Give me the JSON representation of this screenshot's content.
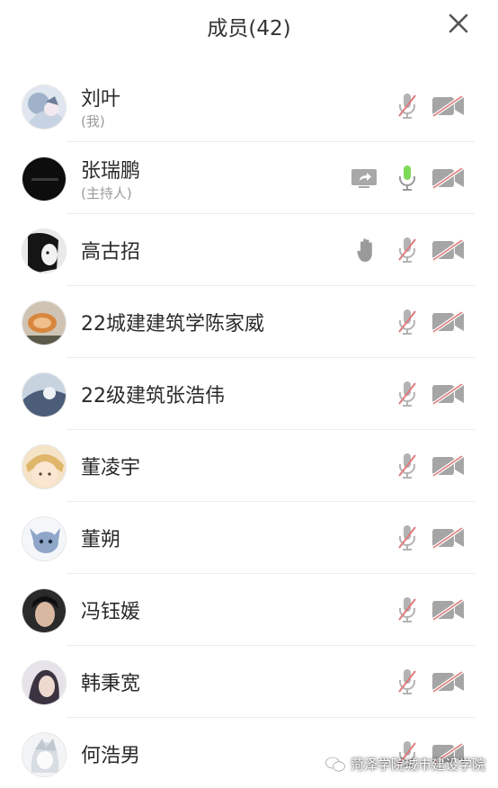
{
  "header": {
    "title": "成员(42)"
  },
  "members": [
    {
      "name": "刘叶",
      "role": "(我)"
    },
    {
      "name": "张瑞鹏",
      "role": "(主持人)"
    },
    {
      "name": "高古招"
    },
    {
      "name": "22城建建筑学陈家威"
    },
    {
      "name": "22级建筑张浩伟"
    },
    {
      "name": "董凌宇"
    },
    {
      "name": "董朔"
    },
    {
      "name": "冯钰媛"
    },
    {
      "name": "韩秉宽"
    },
    {
      "name": "何浩男"
    }
  ],
  "colors": {
    "mic_muted": "#c9a0a0",
    "mic_active": "#7ed957",
    "cam_off": "#9e9e9e",
    "slash": "#e07a7a",
    "divider": "#ececec"
  },
  "watermark": {
    "text": "菏泽学院城市建设学院"
  }
}
